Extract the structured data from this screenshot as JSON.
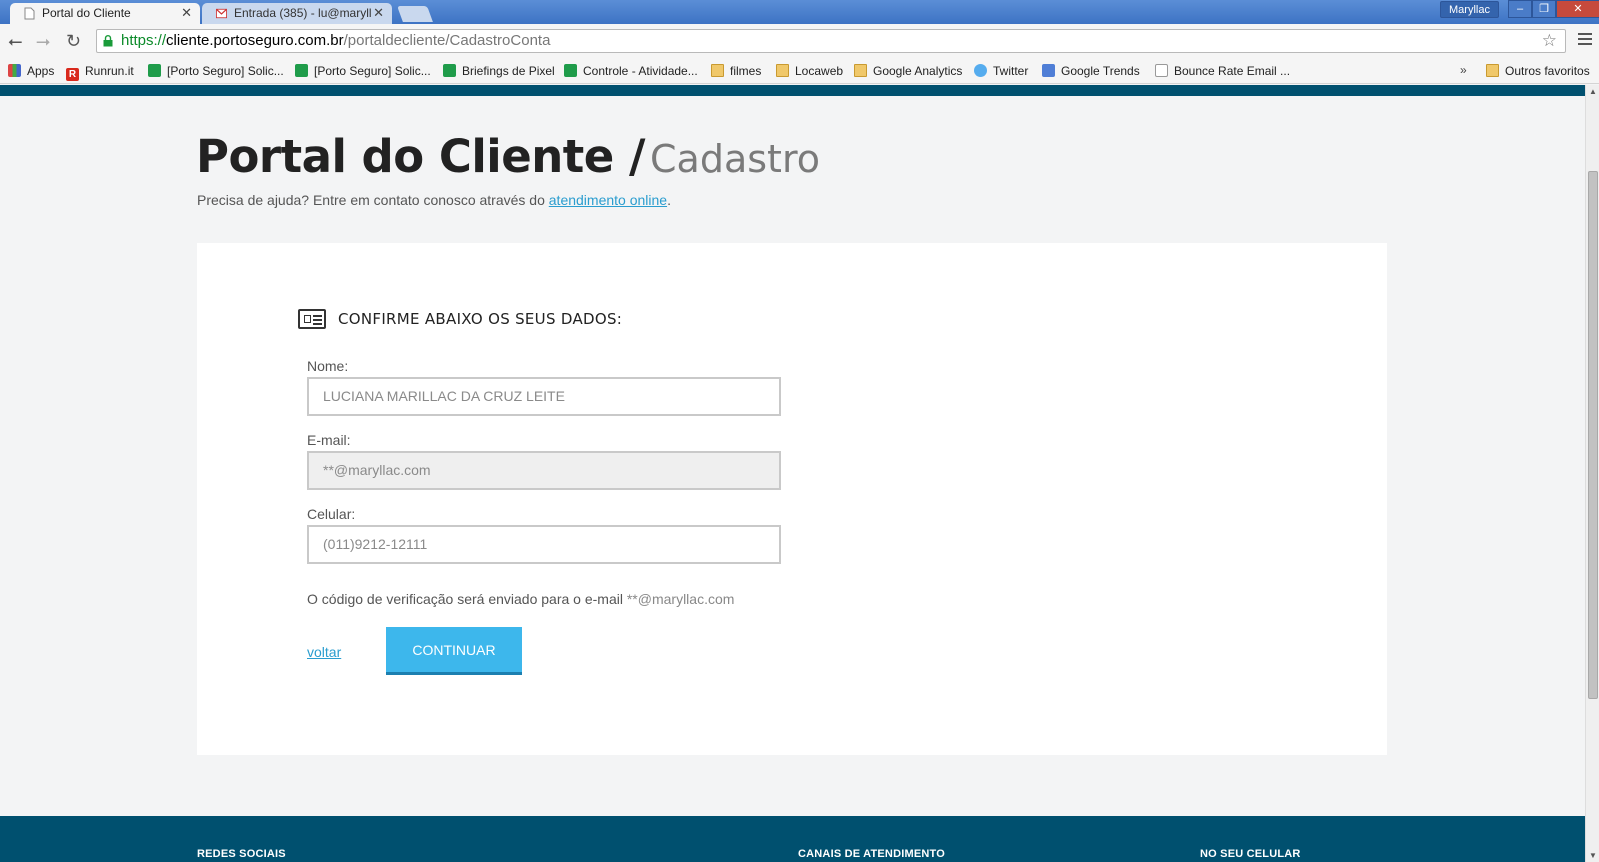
{
  "browser": {
    "tabs": [
      {
        "title": "Portal do Cliente",
        "active": true
      },
      {
        "title": "Entrada (385) - lu@maryll",
        "active": false
      }
    ],
    "profile": "Maryllac",
    "window_controls": {
      "minimize": "–",
      "restore": "❐",
      "close": "✕"
    },
    "url": {
      "scheme": "https://",
      "host": "cliente.portoseguro.com.br",
      "path": "/portaldecliente/CadastroConta"
    },
    "bookmarks": [
      {
        "label": "Apps",
        "icon": "apps"
      },
      {
        "label": "Runrun.it",
        "icon": "rr"
      },
      {
        "label": "[Porto Seguro] Solic...",
        "icon": "sheet"
      },
      {
        "label": "[Porto Seguro] Solic...",
        "icon": "sheet"
      },
      {
        "label": "Briefings de Pixel",
        "icon": "sheet"
      },
      {
        "label": "Controle - Atividade...",
        "icon": "sheet"
      },
      {
        "label": "filmes",
        "icon": "folder"
      },
      {
        "label": "Locaweb",
        "icon": "folder"
      },
      {
        "label": "Google Analytics",
        "icon": "folder"
      },
      {
        "label": "Twitter",
        "icon": "tw"
      },
      {
        "label": "Google Trends",
        "icon": "gt"
      },
      {
        "label": "Bounce Rate Email ...",
        "icon": "doc"
      }
    ],
    "bookmarks_overflow": "»",
    "other_bookmarks": "Outros favoritos"
  },
  "page": {
    "title_main": "Portal do Cliente /",
    "title_sub": "Cadastro",
    "help_text": "Precisa de ajuda? Entre em contato conosco através do",
    "help_link": "atendimento online",
    "help_end": ".",
    "section_title": "CONFIRME ABAIXO OS SEUS DADOS:",
    "fields": {
      "name_label": "Nome:",
      "name_value": "LUCIANA MARILLAC DA CRUZ LEITE",
      "email_label": "E-mail:",
      "email_value": "**@maryllac.com",
      "phone_label": "Celular:",
      "phone_value": "(011)9212-12111"
    },
    "notice_text": "O código de verificação será enviado para o e-mail",
    "notice_email": "**@maryllac.com",
    "back_label": "voltar",
    "continue_label": "CONTINUAR"
  },
  "footer": {
    "social": "REDES SOCIAIS",
    "channels": "CANAIS DE ATENDIMENTO",
    "mobile": "NO SEU CELULAR"
  },
  "colors": {
    "brand_dark": "#00506f",
    "accent": "#3db7ec",
    "link": "#2a9dcf"
  }
}
